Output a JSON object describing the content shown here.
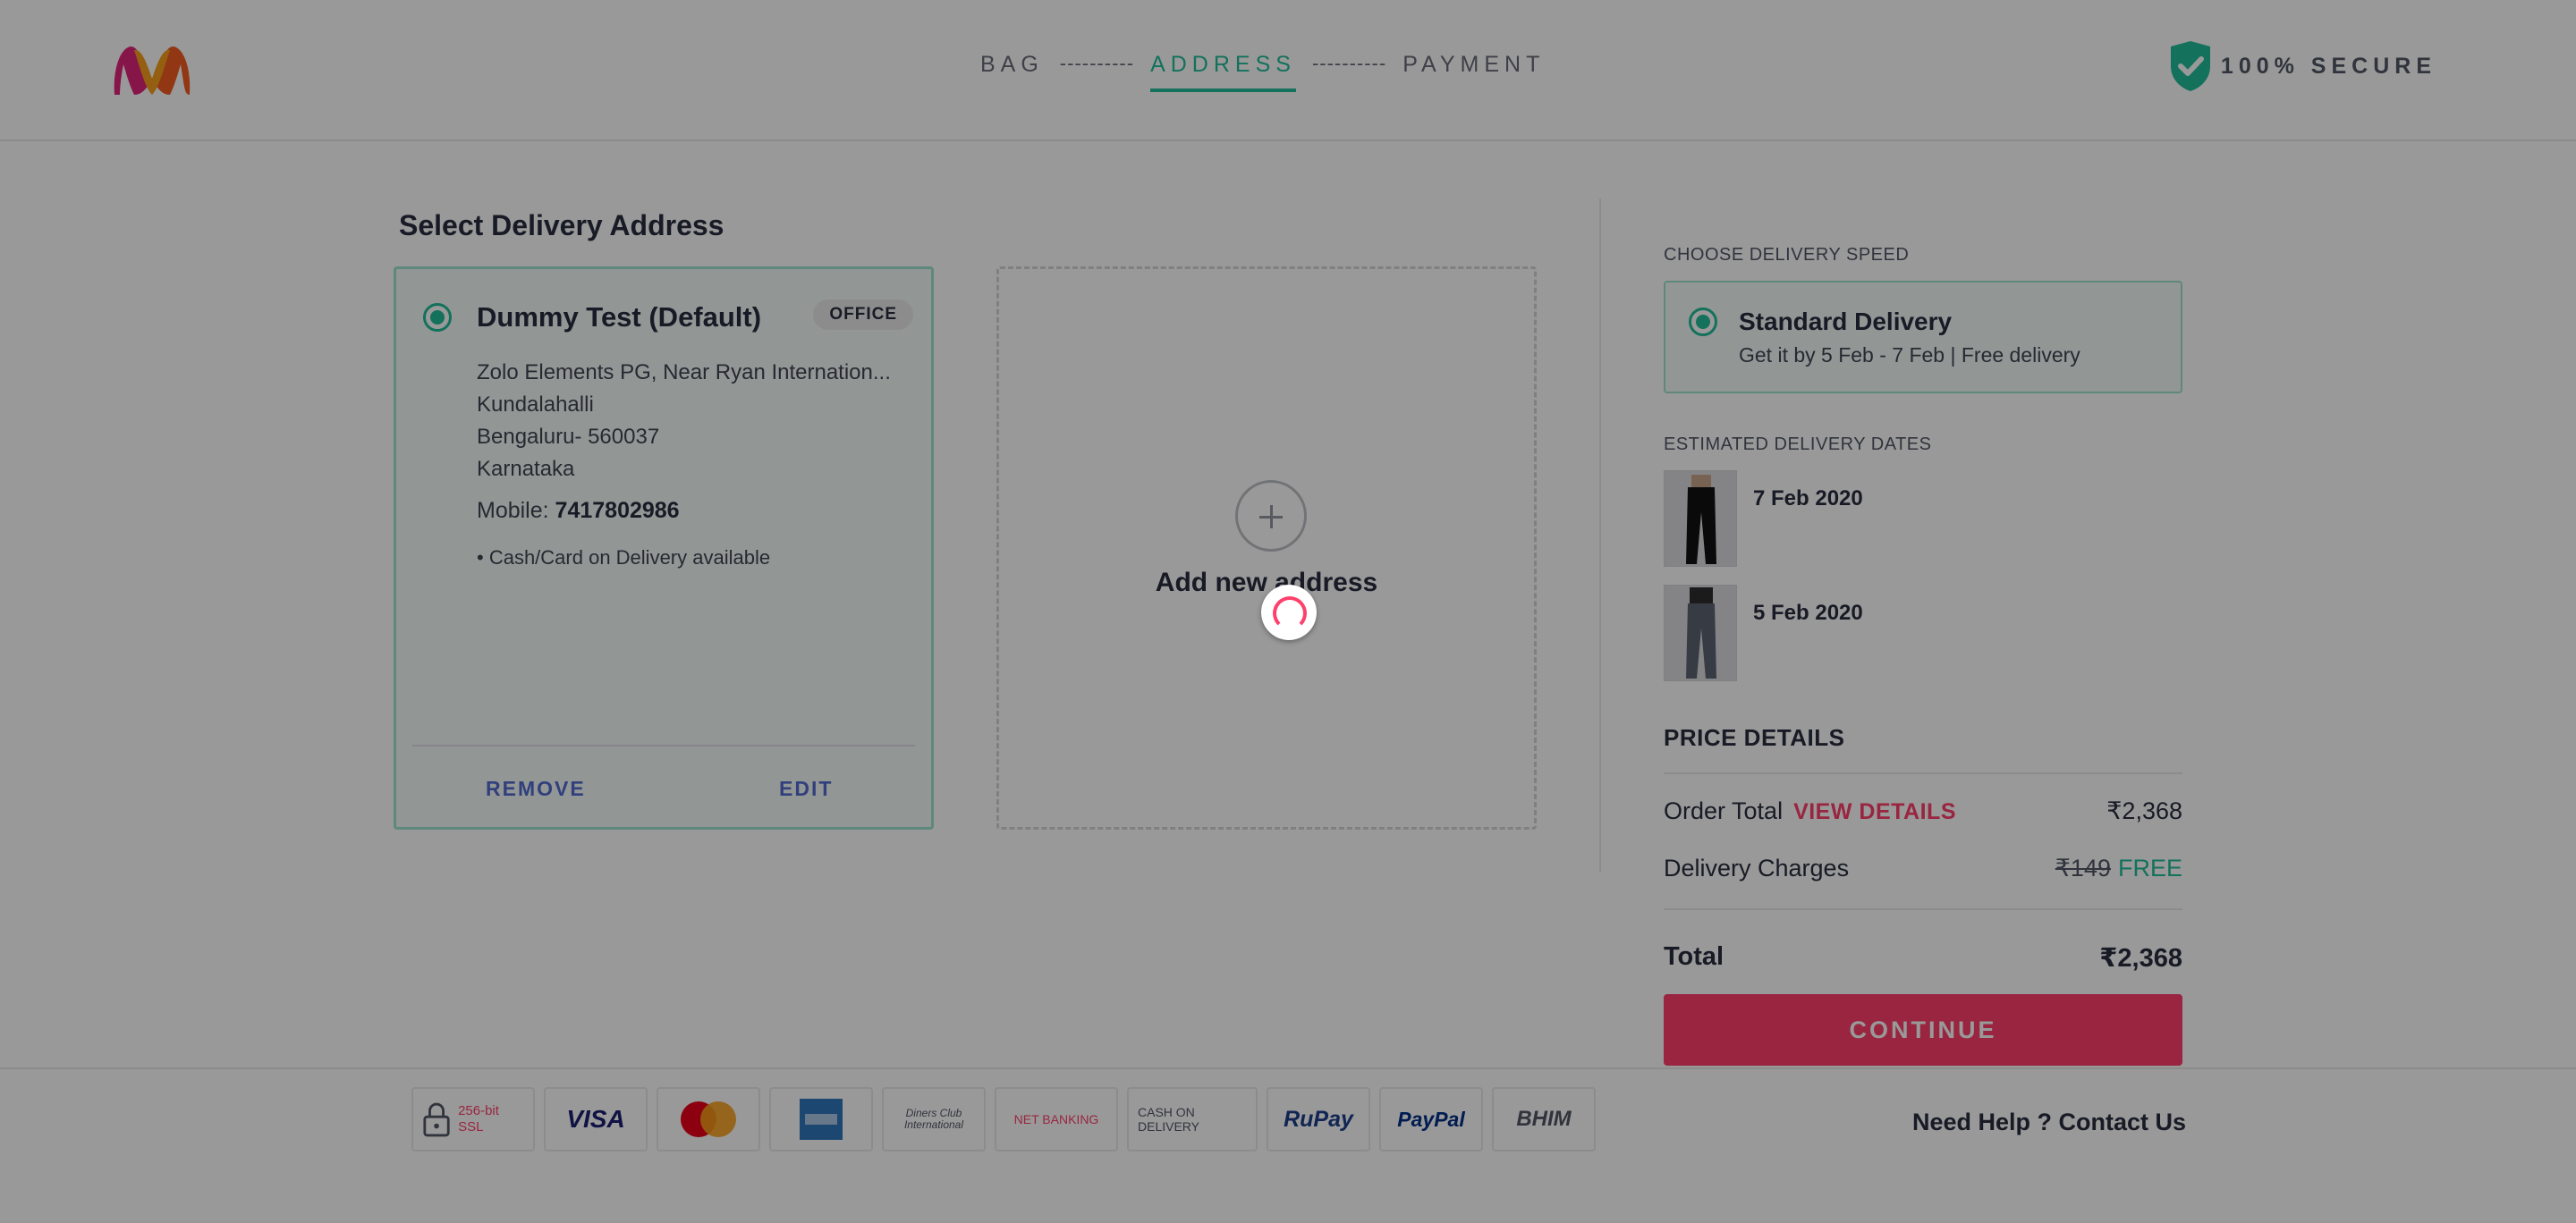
{
  "header": {
    "logo_icon": "myntra-logo-icon",
    "steps": [
      "BAG",
      "ADDRESS",
      "PAYMENT"
    ],
    "active_step": "ADDRESS",
    "step_separator": "----------",
    "secure_label": "100% SECURE",
    "secure_icon": "shield-check-icon"
  },
  "address_section": {
    "title": "Select Delivery Address",
    "address": {
      "name": "Dummy Test (Default)",
      "badge": "OFFICE",
      "lines": [
        "Zolo Elements PG, Near Ryan Internation...",
        "Kundalahalli",
        "Bengaluru- 560037",
        "Karnataka"
      ],
      "mobile_label": "Mobile: ",
      "mobile": "7417802986",
      "cod_note": "• Cash/Card on Delivery available",
      "remove_label": "REMOVE",
      "edit_label": "EDIT",
      "selected": true
    },
    "add_new_label": "Add new address"
  },
  "delivery": {
    "speed_heading": "CHOOSE DELIVERY SPEED",
    "speed_title": "Standard Delivery",
    "speed_sub": "Get it by 5 Feb - 7 Feb | Free delivery",
    "estimated_heading": "ESTIMATED DELIVERY DATES",
    "items": [
      {
        "date": "7 Feb 2020"
      },
      {
        "date": "5 Feb 2020"
      }
    ]
  },
  "price": {
    "heading": "PRICE DETAILS",
    "order_total_label": "Order Total",
    "view_details_label": "VIEW DETAILS",
    "order_total_value": "₹2,368",
    "delivery_label": "Delivery Charges",
    "delivery_original": "₹149",
    "delivery_value": "FREE",
    "total_label": "Total",
    "total_value": "₹2,368",
    "continue_label": "CONTINUE"
  },
  "footer": {
    "payment_logos": [
      "256-bit SSL",
      "VISA",
      "MasterCard",
      "AMEX",
      "Diners Club International",
      "NET BANKING",
      "CASH ON DELIVERY",
      "RuPay",
      "PayPal",
      "BHIM"
    ],
    "help_label": "Need Help ? Contact Us"
  },
  "colors": {
    "accent_green": "#20bd99",
    "brand_pink": "#ff3f6c",
    "link_blue": "#526cd0",
    "overlay": "rgba(0,0,0,0.40)"
  }
}
